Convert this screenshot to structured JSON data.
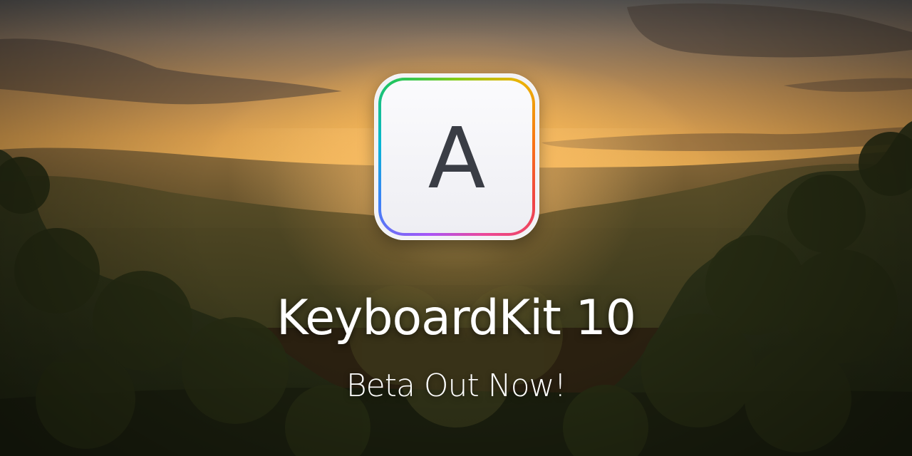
{
  "banner": {
    "app_icon": {
      "icon": "keyboard-key-a-icon",
      "letter": "A",
      "ring_colors": [
        "#a855f7",
        "#3b82f6",
        "#06b6d4",
        "#22c55e",
        "#eab308",
        "#f97316",
        "#ef4444",
        "#ec4899"
      ]
    },
    "title": "KeyboardKit 10",
    "subtitle": "Beta Out Now!"
  },
  "background": {
    "scene": "sunset-over-forest",
    "colors": {
      "sky_top": "#5c5a58",
      "sky_glow": "#e0a650",
      "sun": "#ffe296",
      "forest_dark": "#1f2410",
      "forest_mid": "#3d3a1c"
    }
  }
}
